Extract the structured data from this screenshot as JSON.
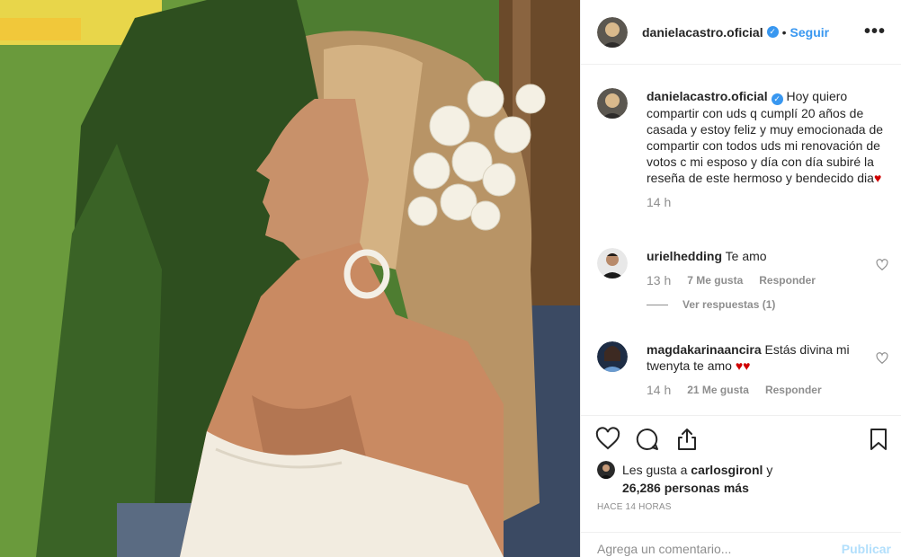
{
  "post": {
    "username": "danielacastro.oficial",
    "verified_mark": "✓",
    "dot": "•",
    "follow_label": "Seguir",
    "more_label": "•••"
  },
  "caption": {
    "username": "danielacastro.oficial",
    "text": "Hoy quiero compartir con uds q cumplí 20 años de casada y estoy feliz y muy emocionada de compartir con todos uds mi renovación de votos c mi esposo y día con día subiré la reseña de este hermoso y bendecido dia",
    "emoji": "♥",
    "time": "14 h"
  },
  "comments": [
    {
      "username": "urielhedding",
      "text": "Te amo",
      "time": "13 h",
      "likes": "7 Me gusta",
      "reply_label": "Responder",
      "view_replies": "Ver respuestas (1)"
    },
    {
      "username": "magdakarinaancira",
      "text": "Estás divina mi twenyta te amo",
      "emoji": "♥♥",
      "time": "14 h",
      "likes": "21 Me gusta",
      "reply_label": "Responder"
    }
  ],
  "likes": {
    "prefix": "Les gusta a",
    "user": "carlosgironl",
    "joiner": "y",
    "count": "26,286 personas más"
  },
  "time_ago": "HACE 14 HORAS",
  "add_comment": {
    "placeholder": "Agrega un comentario...",
    "post_label": "Publicar"
  },
  "colors": {
    "accent": "#3897f0",
    "muted": "#8e8e8e",
    "heart": "#d00000"
  },
  "icons": [
    "heart-icon",
    "comment-icon",
    "share-icon",
    "bookmark-icon",
    "verified-icon",
    "more-icon"
  ]
}
